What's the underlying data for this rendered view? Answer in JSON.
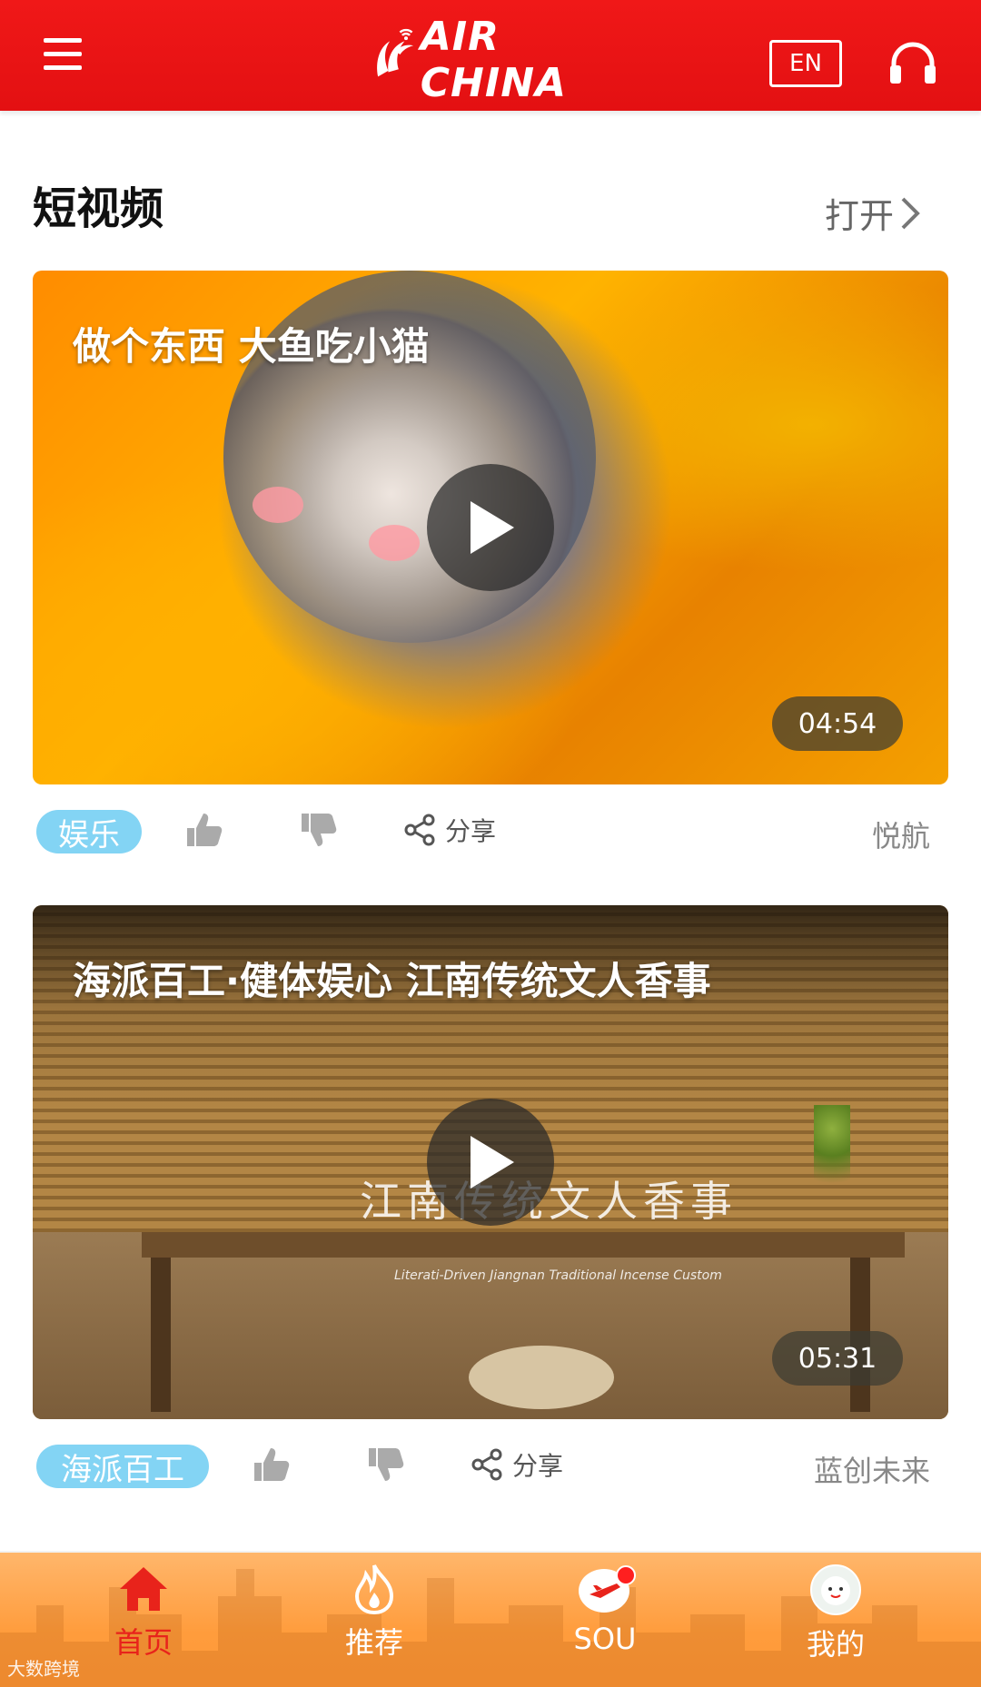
{
  "header": {
    "brand": "AIR CHINA",
    "lang_label": "EN"
  },
  "section": {
    "title": "短视频",
    "open_label": "打开"
  },
  "videos": [
    {
      "title": "做个东西 大鱼吃小猫",
      "duration": "04:54",
      "tag": "娱乐",
      "share_label": "分享",
      "source": "悦航"
    },
    {
      "title": "海派百工·健体娱心 江南传统文人香事",
      "duration": "05:31",
      "tag": "海派百工",
      "share_label": "分享",
      "source": "蓝创未来",
      "overlay_text": "江南传统文人香事",
      "overlay_subtext": "Literati-Driven Jiangnan Traditional Incense Custom"
    }
  ],
  "bottom_nav": {
    "items": [
      {
        "label": "首页",
        "icon": "home-icon",
        "active": true
      },
      {
        "label": "推荐",
        "icon": "flame-icon",
        "active": false
      },
      {
        "label": "SOU",
        "icon": "plane-search-icon",
        "active": false
      },
      {
        "label": "我的",
        "icon": "avatar-icon",
        "active": false
      }
    ]
  },
  "watermark": "大数跨境",
  "colors": {
    "header_red": "#e31012",
    "tag_blue": "#83d4f4",
    "nav_orange": "#ff9c3c",
    "active_red": "#e8231b"
  }
}
